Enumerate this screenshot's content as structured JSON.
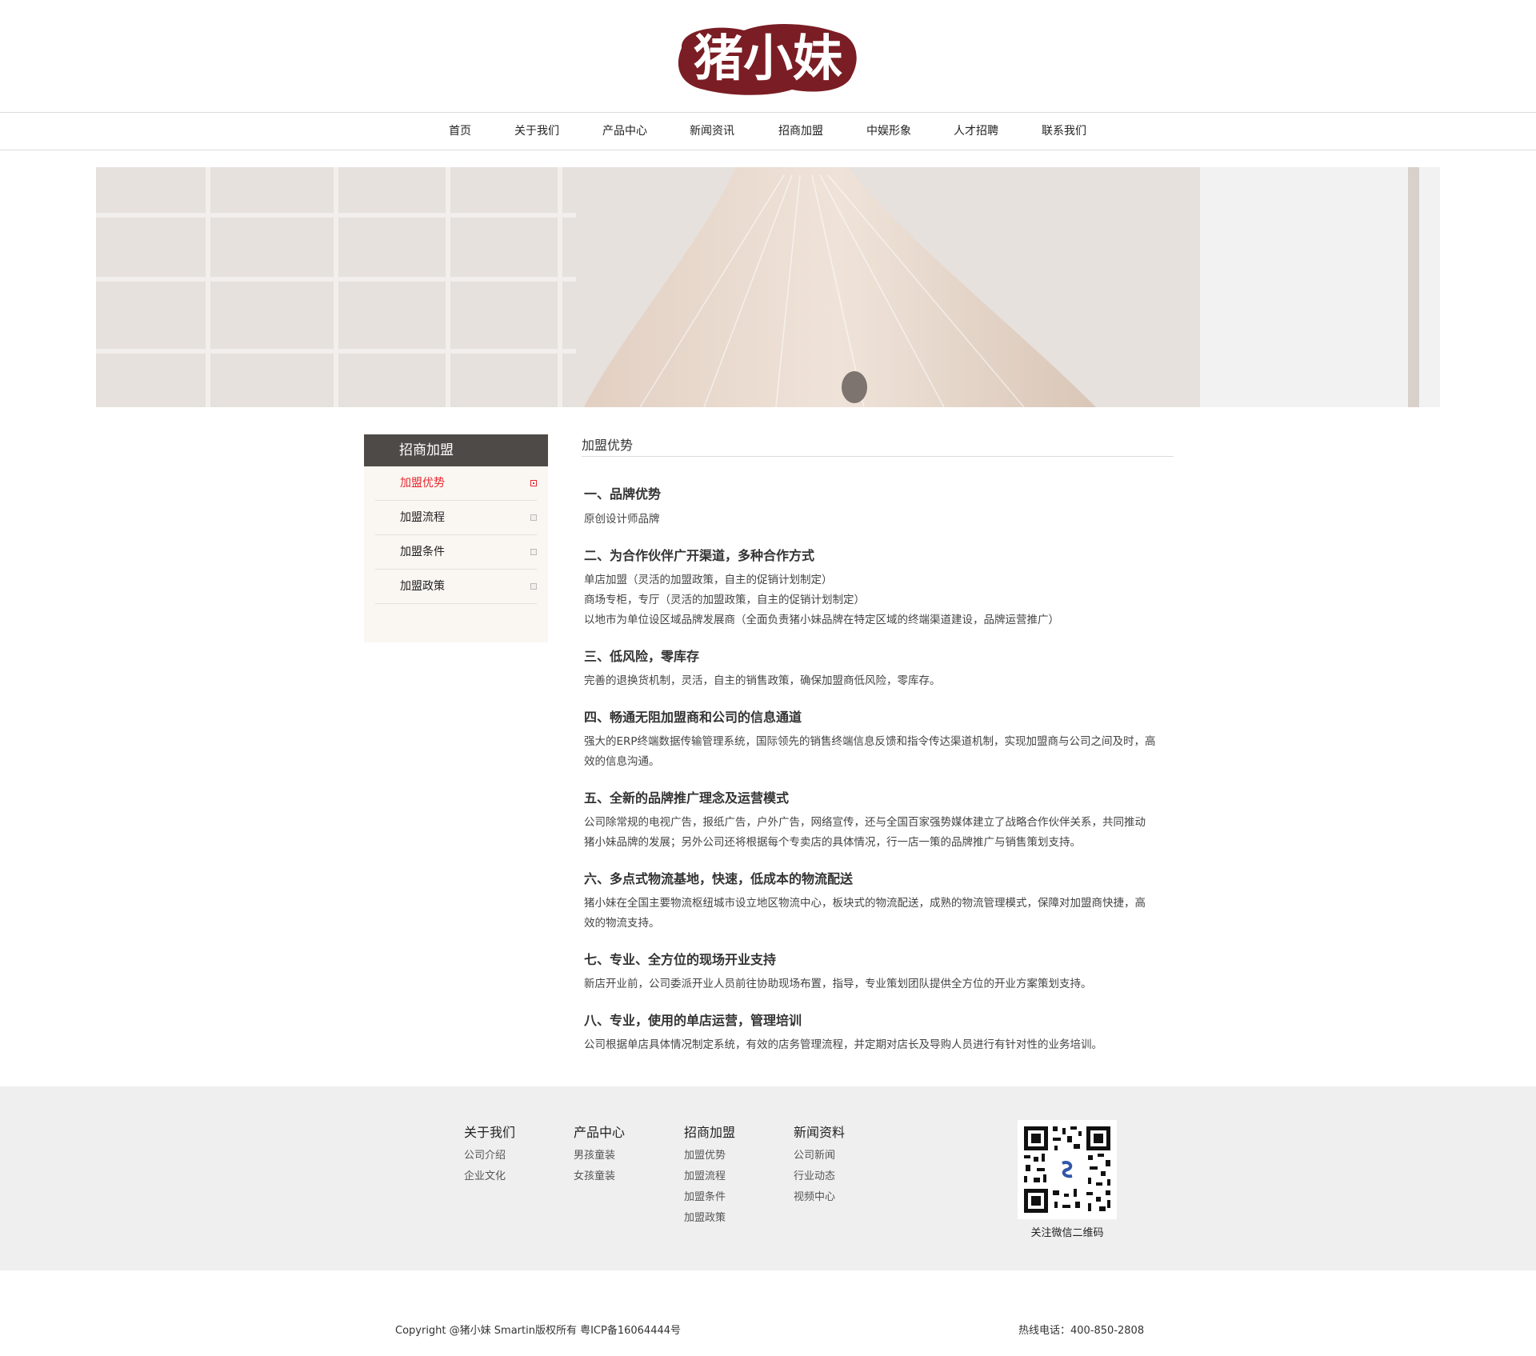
{
  "brand": {
    "logo_text": "猪小妹",
    "accent_color": "#7b1d24"
  },
  "nav": {
    "items": [
      "首页",
      "关于我们",
      "产品中心",
      "新闻资讯",
      "招商加盟",
      "中娱形象",
      "人才招聘",
      "联系我们"
    ]
  },
  "sidebar": {
    "title": "招商加盟",
    "items": [
      {
        "label": "加盟优势",
        "active": true
      },
      {
        "label": "加盟流程",
        "active": false
      },
      {
        "label": "加盟条件",
        "active": false
      },
      {
        "label": "加盟政策",
        "active": false
      }
    ]
  },
  "content": {
    "title": "加盟优势",
    "sections": [
      {
        "heading": "一、品牌优势",
        "lines": [
          "原创设计师品牌"
        ]
      },
      {
        "heading": "二、为合作伙伴广开渠道，多种合作方式",
        "lines": [
          "单店加盟（灵活的加盟政策，自主的促销计划制定）",
          "商场专柜，专厅（灵活的加盟政策，自主的促销计划制定）",
          "以地市为单位设区域品牌发展商（全面负责猪小妹品牌在特定区域的终端渠道建设，品牌运营推广）"
        ]
      },
      {
        "heading": "三、低风险，零库存",
        "lines": [
          "完善的退换货机制，灵活，自主的销售政策，确保加盟商低风险，零库存。"
        ]
      },
      {
        "heading": "四、畅通无阻加盟商和公司的信息通道",
        "lines": [
          "强大的ERP终端数据传输管理系统，国际领先的销售终端信息反馈和指令传达渠道机制，实现加盟商与公司之间及时，高",
          "效的信息沟通。"
        ]
      },
      {
        "heading": "五、全新的品牌推广理念及运营模式",
        "lines": [
          "公司除常规的电视广告，报纸广告，户外广告，网络宣传，还与全国百家强势媒体建立了战略合作伙伴关系，共同推动",
          "猪小妹品牌的发展；另外公司还将根据每个专卖店的具体情况，行一店一策的品牌推广与销售策划支持。"
        ]
      },
      {
        "heading": "六、多点式物流基地，快速，低成本的物流配送",
        "lines": [
          "猪小妹在全国主要物流枢纽城市设立地区物流中心，板块式的物流配送，成熟的物流管理模式，保障对加盟商快捷，高",
          "效的物流支持。"
        ]
      },
      {
        "heading": "七、专业、全方位的现场开业支持",
        "lines": [
          "新店开业前，公司委派开业人员前往协助现场布置，指导，专业策划团队提供全方位的开业方案策划支持。"
        ]
      },
      {
        "heading": "八、专业，使用的单店运营，管理培训",
        "lines": [
          "公司根据单店具体情况制定系统，有效的店务管理流程，并定期对店长及导购人员进行有针对性的业务培训。"
        ]
      }
    ]
  },
  "footer": {
    "columns": [
      {
        "title": "关于我们",
        "links": [
          "公司介绍",
          "企业文化"
        ]
      },
      {
        "title": "产品中心",
        "links": [
          "男孩童装",
          "女孩童装"
        ]
      },
      {
        "title": "招商加盟",
        "links": [
          "加盟优势",
          "加盟流程",
          "加盟条件",
          "加盟政策"
        ]
      },
      {
        "title": "新闻资料",
        "links": [
          "公司新闻",
          "行业动态",
          "视频中心"
        ]
      }
    ],
    "qr_label": "关注微信二维码",
    "copyright": "Copyright @猪小妹 Smartin版权所有  粤ICP备16064444号",
    "hotline": "热线电话：400-850-2808"
  }
}
